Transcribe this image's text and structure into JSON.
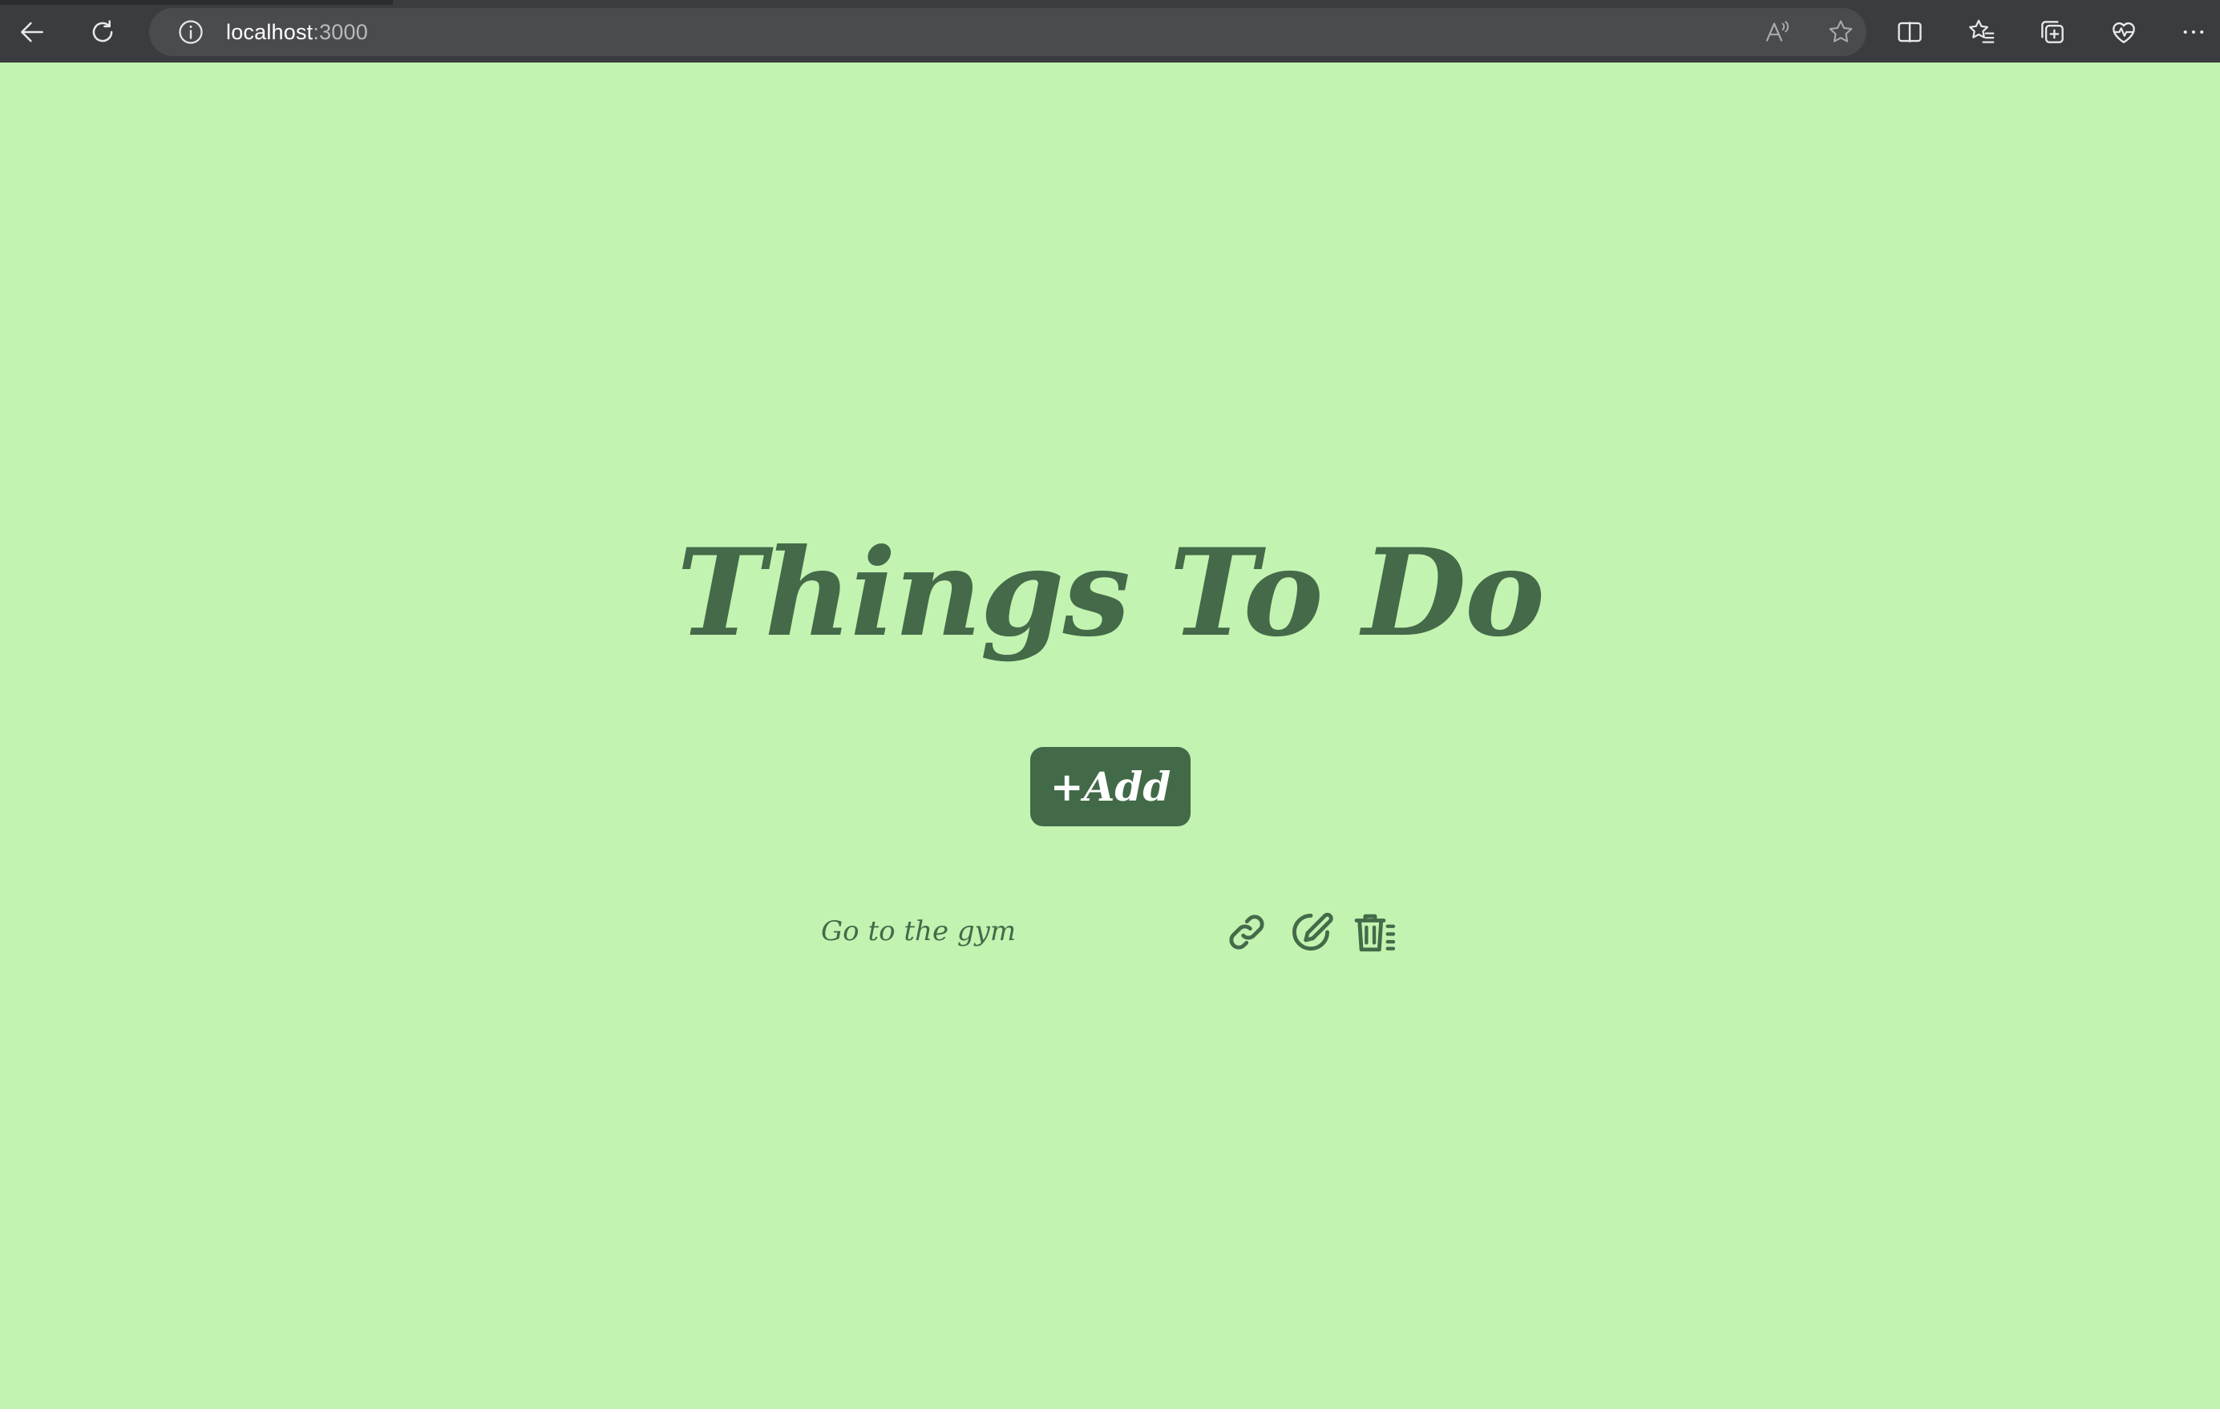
{
  "browser": {
    "url_host": "localhost",
    "url_port": ":3000",
    "icons": {
      "back": "back-arrow-icon",
      "refresh": "refresh-icon",
      "site_info": "info-icon",
      "read_aloud": "read-aloud-icon",
      "favorite": "star-icon",
      "split_screen": "split-screen-icon",
      "favorites": "favorites-list-icon",
      "collections": "collections-icon",
      "health": "browser-essentials-icon",
      "menu": "more-icon"
    },
    "colors": {
      "toolbar": "#3b3c3f",
      "urlbar": "#4a4b4f"
    }
  },
  "page": {
    "title": "Things To Do",
    "add_button_label": "+Add",
    "colors": {
      "background": "#c2f3b0",
      "primary": "#446a4a",
      "button_text": "#ffffff"
    },
    "todos": [
      {
        "text": "Go to the gym",
        "actions": [
          "link-icon",
          "edit-icon",
          "delete-icon"
        ]
      }
    ]
  }
}
